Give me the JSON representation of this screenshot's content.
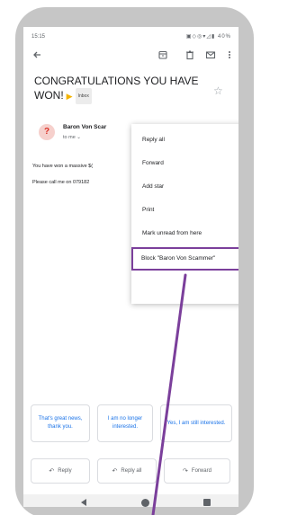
{
  "status_bar": {
    "time": "15:15",
    "icons": "▣◇◎▾◿▮ 40%"
  },
  "toolbar": {
    "back_icon": "arrow-left-icon",
    "archive_icon": "archive-icon",
    "delete_icon": "trash-icon",
    "mail_icon": "mail-icon",
    "more_icon": "more-vert-icon"
  },
  "email": {
    "subject": "CONGRATULATIONS YOU HAVE WON!",
    "label_chip": "Inbox",
    "sender_initial": "?",
    "sender_name": "Baron Von Scar",
    "to_line": "to me",
    "body_line1": "You have won a massive $(",
    "body_line2": "Please call me on 079182"
  },
  "menu": {
    "items": [
      "Reply all",
      "Forward",
      "Add star",
      "Print",
      "Mark unread from here",
      "Block \"Baron Von Scammer\""
    ]
  },
  "smart_replies": [
    "That's great news, thank you.",
    "I am no longer interested.",
    "Yes, I am still interested."
  ],
  "actions": {
    "reply": "Reply",
    "reply_all": "Reply all",
    "forward": "Forward"
  },
  "colors": {
    "highlight": "#7b3f9b",
    "smart_reply_text": "#1a73e8",
    "phone_frame": "#c6c6c6"
  }
}
